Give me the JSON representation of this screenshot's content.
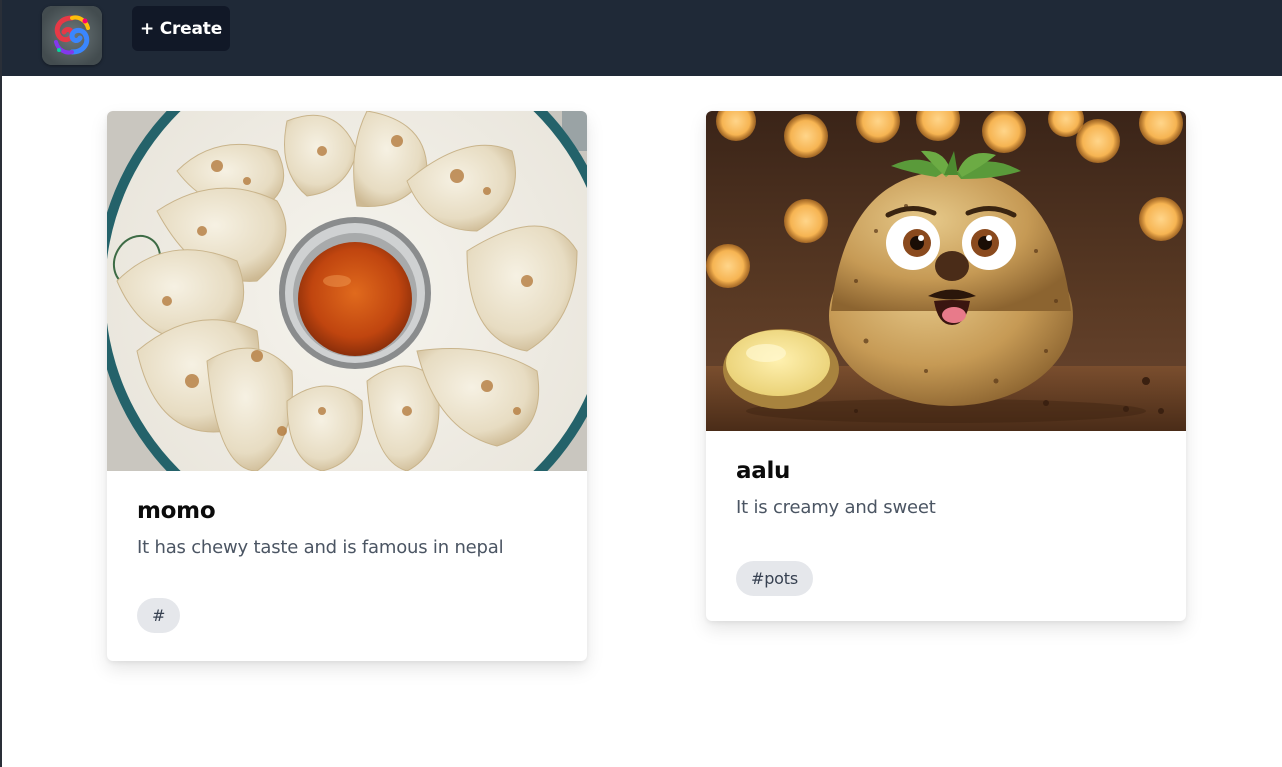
{
  "header": {
    "logo_icon": "app-logo-swirl-icon",
    "create_label": "+ Create"
  },
  "posts": [
    {
      "title": "momo",
      "description": "It has chewy taste and is famous in nepal",
      "tag": "#",
      "image_icon": "momo-dumplings-photo"
    },
    {
      "title": "aalu",
      "description": "It is creamy and sweet",
      "tag": "#pots",
      "image_icon": "cartoon-potato-photo"
    }
  ],
  "colors": {
    "navbar": "#1f2937",
    "create_button": "#111827",
    "tag_background": "#e5e7eb",
    "description_text": "#4b5563"
  }
}
